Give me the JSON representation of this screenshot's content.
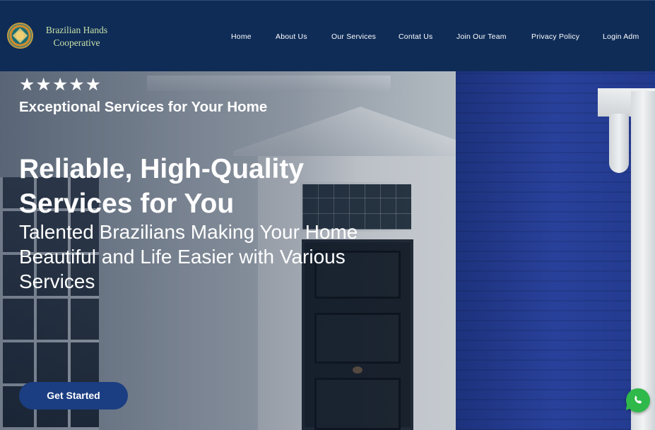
{
  "brand": {
    "line1": "Brazilian Hands",
    "line2": "Cooperative",
    "logo_icon": "mandala-logo-icon"
  },
  "nav": {
    "items": [
      {
        "label": "Home"
      },
      {
        "label": "About Us"
      },
      {
        "label": "Our Services"
      },
      {
        "label": "Contat Us"
      },
      {
        "label": "Join Our Team"
      },
      {
        "label": "Privacy Policy"
      },
      {
        "label": "Login Adm"
      }
    ]
  },
  "hero": {
    "rating": "★★★★★",
    "tagline": "Exceptional Services for Your Home",
    "headline": "Reliable, High-Quality Services for You",
    "subheadline": "Talented Brazilians Making Your Home Beautiful and Life Easier with Various Services",
    "cta_label": "Get Started"
  },
  "floating": {
    "whatsapp_icon": "whatsapp-icon"
  },
  "colors": {
    "header_bg": "#0f2c57",
    "brand_text": "#c7e0a8",
    "cta_bg": "#1b3e82",
    "whatsapp_green": "#2fb94a"
  }
}
